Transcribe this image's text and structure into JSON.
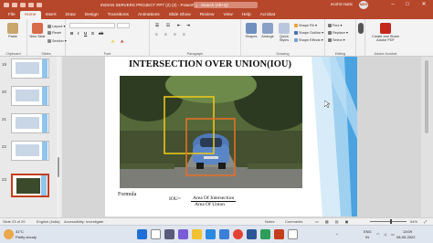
{
  "titlebar": {
    "document_title": "INDIAN SERVERS PROJECT PPT (2) (2)  -  PowerPoint",
    "search_placeholder": "Search (Alt+Q)",
    "user_name": "ecohit maric",
    "avatar_initials": "MKR",
    "minimize": "–",
    "maximize": "□",
    "close": "✕"
  },
  "menu": {
    "tabs": [
      "File",
      "Home",
      "Insert",
      "Draw",
      "Design",
      "Transitions",
      "Animations",
      "Slide Show",
      "Review",
      "View",
      "Help",
      "Acrobat"
    ],
    "active_tab": "Home"
  },
  "ribbon": {
    "clipboard": {
      "label": "Clipboard",
      "paste": "Paste"
    },
    "slides": {
      "label": "Slides",
      "new_slide": "New Slide",
      "layout": "Layout ▾",
      "reset": "Reset",
      "section": "Section ▾"
    },
    "font": {
      "label": "Font"
    },
    "paragraph": {
      "label": "Paragraph"
    },
    "drawing": {
      "label": "Drawing",
      "shapes": "Shapes",
      "arrange": "Arrange",
      "quick_styles": "Quick Styles",
      "shape_fill": "Shape Fill ▾",
      "shape_outline": "Shape Outline ▾",
      "shape_effects": "Shape Effects ▾"
    },
    "editing": {
      "label": "Editing",
      "find": "Find ▾",
      "replace": "Replace ▾",
      "select": "Select ▾"
    },
    "voice": {
      "label": "Voice",
      "dictate": "Dictate"
    },
    "adobe": {
      "label": "Adobe Acrobat",
      "create_share": "Create and Share Adobe PDF"
    }
  },
  "thumbnails": [
    {
      "number": "19",
      "selected": false
    },
    {
      "number": "20",
      "selected": false
    },
    {
      "number": "21",
      "selected": false
    },
    {
      "number": "22",
      "selected": false
    },
    {
      "number": "23",
      "selected": true
    }
  ],
  "slide": {
    "title": "INTERSECTION OVER UNION(IOU)",
    "formula_label": "Formula",
    "iou_prefix": "IOU=",
    "numerator": "Area Of Intersection",
    "denominator": "Area Of Union"
  },
  "status": {
    "slide_count": "Slide 23 of 29",
    "language": "English (India)",
    "accessibility": "Accessibility: Investigate",
    "notes": "Notes",
    "comments": "Comments",
    "zoom": "54%"
  },
  "taskbar": {
    "weather_temp": "31°C",
    "weather_desc": "Partly cloudy",
    "lang_top": "ENG",
    "lang_bottom": "IN",
    "time": "13:09",
    "date": "08-05-2022"
  },
  "colors": {
    "brand": "#b7472a",
    "bbox_yellow": "#e8c61c",
    "bbox_orange": "#e0702a",
    "selected_thumb": "#c43e1c"
  }
}
